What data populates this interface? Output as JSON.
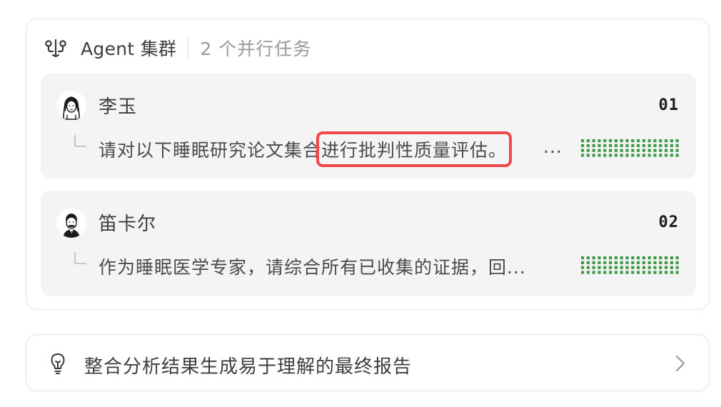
{
  "cluster": {
    "title": "Agent 集群",
    "count_text": "2 个并行任务",
    "header_icon": "agent-cluster-icon"
  },
  "tasks": [
    {
      "agent_name": "李玉",
      "index": "01",
      "description_before": "请对以下睡眠研究论文集合",
      "description_highlight": "进行批判性质量评估。",
      "ellipsis": "...",
      "avatar": "woman-avatar",
      "status_color": "#3f9b4a"
    },
    {
      "agent_name": "笛卡尔",
      "index": "02",
      "description": "作为睡眠医学专家，请综合所有已收集的证据，回...",
      "avatar": "man-avatar",
      "status_color": "#3f9b4a"
    }
  ],
  "report": {
    "label": "整合分析结果生成易于理解的最终报告",
    "icon": "lightbulb-icon",
    "chevron": "chevron-right-icon"
  },
  "colors": {
    "highlight_border": "#f0484d",
    "progress_green": "#3f9b4a",
    "card_background": "#f4f4f4"
  }
}
